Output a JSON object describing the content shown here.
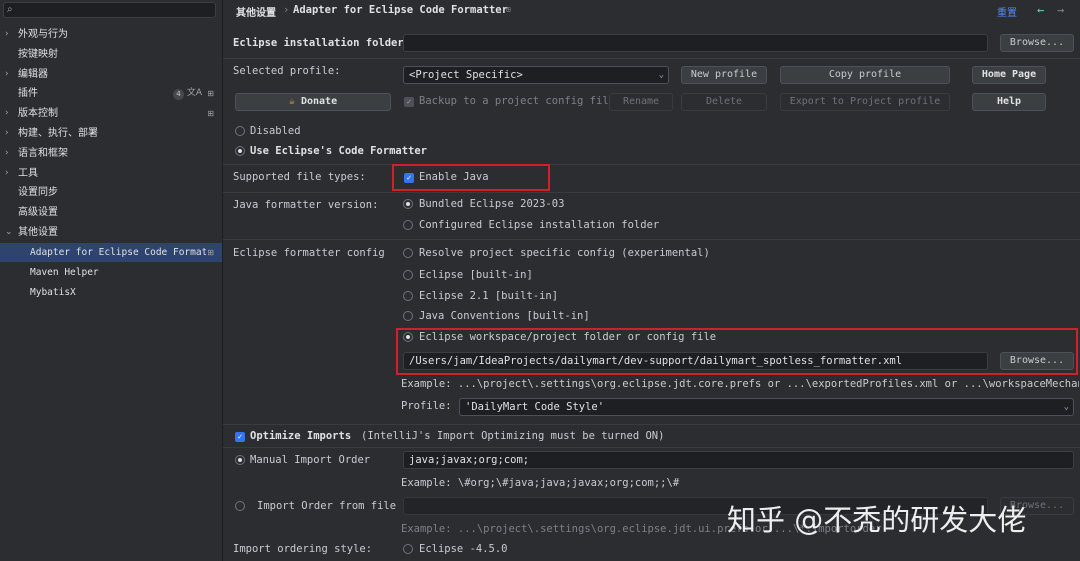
{
  "sidebar": {
    "search_icon": "search-icon",
    "items": [
      {
        "label": "外观与行为",
        "arrow": "›"
      },
      {
        "label": "按键映射"
      },
      {
        "label": "编辑器",
        "arrow": "›"
      },
      {
        "label": "插件",
        "badge": "4",
        "translate": "文A",
        "mark": "⊞"
      },
      {
        "label": "版本控制",
        "arrow": "›",
        "mark": "⊞"
      },
      {
        "label": "构建、执行、部署",
        "arrow": "›"
      },
      {
        "label": "语言和框架",
        "arrow": "›"
      },
      {
        "label": "工具",
        "arrow": "›"
      },
      {
        "label": "设置同步"
      },
      {
        "label": "高级设置"
      },
      {
        "label": "其他设置",
        "arrow": "⌄"
      },
      {
        "label": "Adapter for Eclipse Code Formatter",
        "mark": "⊞"
      },
      {
        "label": "Maven Helper"
      },
      {
        "label": "MybatisX"
      }
    ]
  },
  "header": {
    "crumb1": "其他设置",
    "sep": "›",
    "crumb2": "Adapter for Eclipse Code Formatter",
    "crumb_mark": "⊞",
    "reset": "重置",
    "back": "←",
    "forward": "→"
  },
  "form": {
    "install_label": "Eclipse installation folder",
    "install_value": "",
    "browse": "Browse...",
    "profile_label": "Selected profile:",
    "profile_value": "<Project Specific>",
    "new_profile": "New profile",
    "copy_profile": "Copy profile",
    "home_page": "Home Page",
    "donate": "Donate",
    "backup": "Backup to a project config file",
    "rename": "Rename",
    "delete": "Delete",
    "export": "Export to Project profile",
    "help": "Help",
    "disabled": "Disabled",
    "use_eclipse": "Use Eclipse's Code Formatter",
    "supported_label": "Supported file types:",
    "enable_java": "Enable Java",
    "version_label": "Java formatter version:",
    "bundled": "Bundled Eclipse 2023-03",
    "configured": "Configured Eclipse installation folder",
    "config_label": "Eclipse formatter config",
    "opt_resolve": "Resolve project specific config (experimental)",
    "opt_builtin": "Eclipse [built-in]",
    "opt_21": "Eclipse 2.1 [built-in]",
    "opt_conv": "Java Conventions [built-in]",
    "opt_workspace": "Eclipse workspace/project folder or config file",
    "config_path": "/Users/jam/IdeaProjects/dailymart/dev-support/dailymart_spotless_formatter.xml",
    "example1": "Example: ...\\project\\.settings\\org.eclipse.jdt.core.prefs or ...\\exportedProfiles.xml or ...\\workspaceMechanic.epf",
    "profile_sub_label": "Profile:",
    "profile_sub_value": "'DailyMart Code Style'",
    "optimize": "Optimize Imports",
    "optimize_note": "(IntelliJ's Import Optimizing must be turned ON)",
    "manual_order": "Manual Import Order",
    "manual_value": "java;javax;org;com;",
    "example2": "Example: \\#org;\\#java;java;javax;org;com;;\\#",
    "import_file": "Import Order from file",
    "import_browse": "Browse...",
    "example3": "Example: ...\\project\\.settings\\org.eclipse.jdt.ui.prefs or ...\\*.importorder",
    "ordering_label": "Import ordering style:",
    "ordering_value": "Eclipse -4.5.0"
  },
  "watermark": "知乎 @不秃的研发大佬",
  "colors": {
    "accent": "#3574f0",
    "selection": "#2e436e",
    "highlight_box": "#d0202a"
  }
}
